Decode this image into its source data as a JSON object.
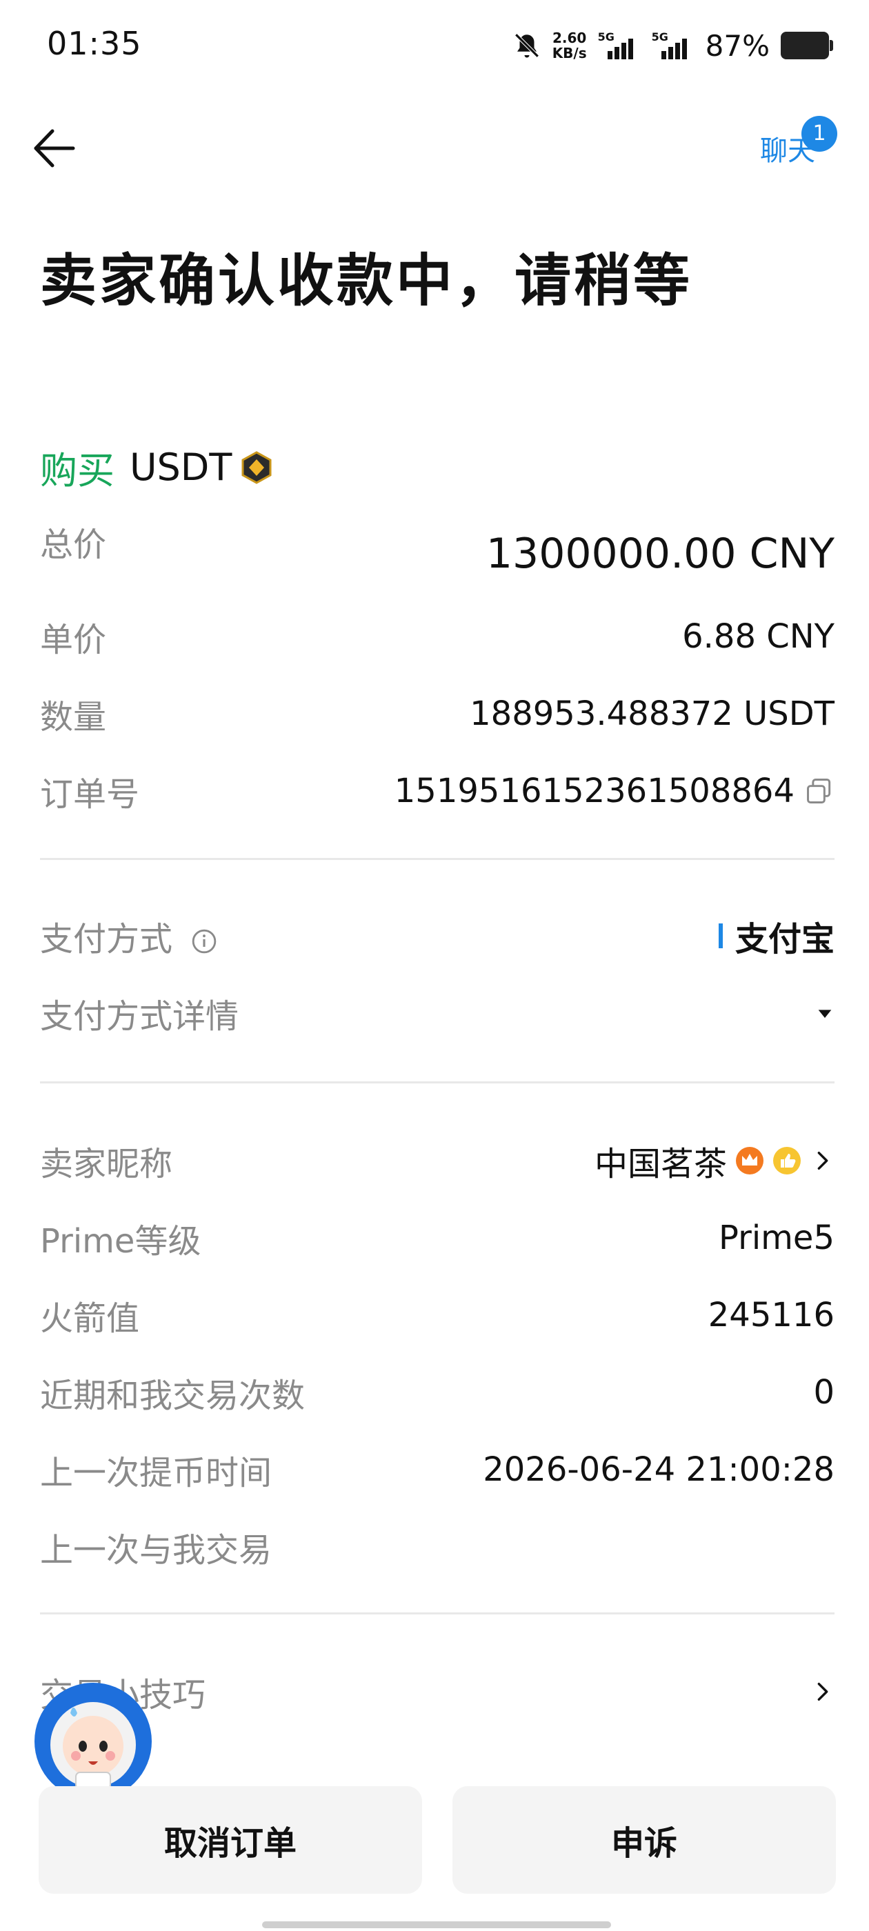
{
  "status_bar": {
    "time": "01:35",
    "net_speed_value": "2.60",
    "net_speed_unit": "KB/s",
    "signal1_label": "5G",
    "signal2_label": "5G",
    "battery_percent": "87%",
    "battery_level": 0.87,
    "icons": [
      "bell-muted-icon",
      "signal-icon",
      "signal-icon",
      "battery-icon"
    ]
  },
  "header": {
    "back_icon": "arrow-left-icon",
    "chat_label": "聊天",
    "chat_badge": "1",
    "title": "卖家确认收款中，请稍等"
  },
  "order": {
    "type_label": "购买",
    "coin": "USDT",
    "rows": [
      {
        "label": "总价",
        "value": "1300000.00 CNY"
      },
      {
        "label": "单价",
        "value": "6.88 CNY"
      },
      {
        "label": "数量",
        "value": "188953.488372 USDT"
      },
      {
        "label": "订单号",
        "value": "1519516152361508864"
      }
    ]
  },
  "payment": {
    "method_label": "支付方式",
    "method_value": "支付宝",
    "details_label": "支付方式详情"
  },
  "seller": {
    "rows": [
      {
        "label": "卖家昵称",
        "value": "中国茗茶"
      },
      {
        "label": "Prime等级",
        "value": "Prime5"
      },
      {
        "label": "火箭值",
        "value": "245116"
      },
      {
        "label": "近期和我交易次数",
        "value": "0"
      },
      {
        "label": "上一次提币时间",
        "value": "2026-06-24 21:00:28"
      },
      {
        "label": "上一次与我交易",
        "value": ""
      }
    ]
  },
  "tips": {
    "label": "交易小技巧"
  },
  "actions": {
    "cancel": "取消订单",
    "appeal": "申诉"
  },
  "colors": {
    "accent": "#1e88e5",
    "buy": "#18a65a",
    "muted": "#8a8a8a"
  }
}
